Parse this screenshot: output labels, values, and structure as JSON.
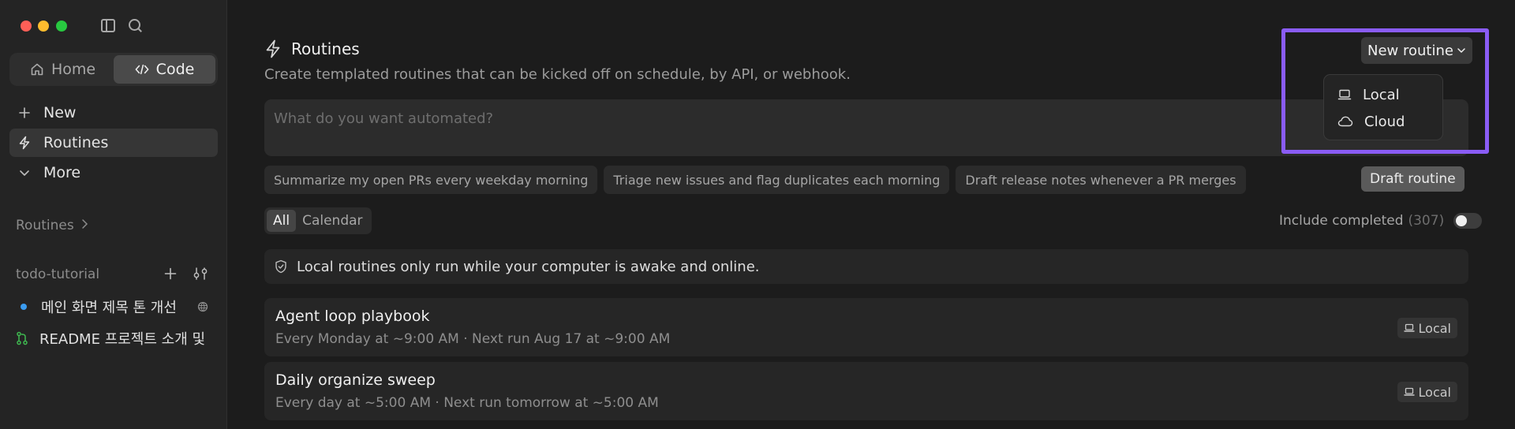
{
  "sidebar": {
    "tabs": [
      {
        "label": "Home",
        "icon": "home-icon"
      },
      {
        "label": "Code",
        "icon": "code-icon"
      }
    ],
    "nav": [
      {
        "label": "New",
        "icon": "plus-icon"
      },
      {
        "label": "Routines",
        "icon": "bolt-icon"
      },
      {
        "label": "More",
        "icon": "chevron-down-icon"
      }
    ],
    "routines_section": "Routines",
    "project": {
      "name": "todo-tutorial",
      "items": [
        {
          "label": "메인 화면 제목 톤 개선",
          "icon": "dot-icon"
        },
        {
          "label": "README 프로젝트 소개 및",
          "icon": "pull-request-icon"
        }
      ]
    }
  },
  "main": {
    "title": "Routines",
    "subtitle": "Create templated routines that can be kicked off on schedule, by API, or webhook.",
    "new_routine": "New routine",
    "dropdown": [
      "Local",
      "Cloud"
    ],
    "prompt_placeholder": "What do you want automated?",
    "suggestions": [
      "Summarize my open PRs every weekday morning",
      "Triage new issues and flag duplicates each morning",
      "Draft release notes whenever a PR merges"
    ],
    "draft_button": "Draft routine",
    "views": [
      "All",
      "Calendar"
    ],
    "include_completed": "Include completed",
    "include_count": "(307)",
    "notice": "Local routines only run while your computer is awake and online.",
    "routines": [
      {
        "title": "Agent loop playbook",
        "schedule": "Every Monday at ~9:00 AM · Next run Aug 17 at ~9:00 AM",
        "badge": "Local"
      },
      {
        "title": "Daily organize sweep",
        "schedule": "Every day at ~5:00 AM · Next run tomorrow at ~5:00 AM",
        "badge": "Local"
      }
    ]
  },
  "colors": {
    "highlight": "#8a5cf5",
    "sidebar_bg": "#242424",
    "main_bg": "#1c1c1c",
    "accent_blue": "#3b9cf0",
    "accent_green": "#3fb950"
  }
}
